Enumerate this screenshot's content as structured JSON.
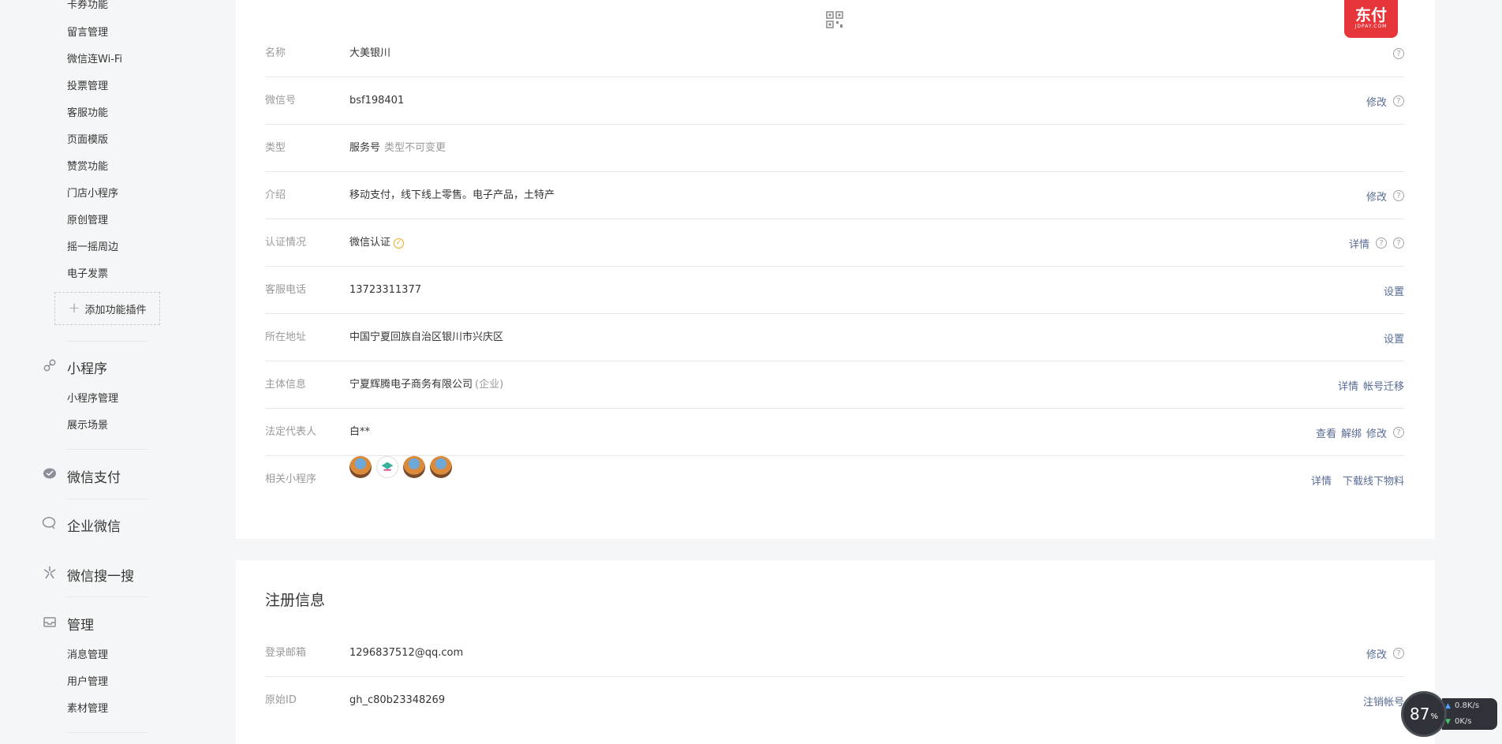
{
  "sidebar": {
    "top_items": [
      "卡券功能",
      "留言管理",
      "微信连Wi-Fi",
      "投票管理",
      "客服功能",
      "页面模版",
      "赞赏功能",
      "门店小程序",
      "原创管理",
      "摇一摇周边",
      "电子发票"
    ],
    "add_plugin_label": "添加功能插件",
    "sections": [
      {
        "title": "小程序",
        "icon": "link-icon",
        "items": [
          "小程序管理",
          "展示场景"
        ]
      },
      {
        "title": "微信支付",
        "icon": "wechat-pay-icon",
        "items": []
      },
      {
        "title": "企业微信",
        "icon": "chat-bubble-icon",
        "items": []
      },
      {
        "title": "微信搜一搜",
        "icon": "search-star-icon",
        "items": []
      },
      {
        "title": "管理",
        "icon": "inbox-icon",
        "items": [
          "消息管理",
          "用户管理",
          "素材管理"
        ]
      }
    ]
  },
  "brand_badge": {
    "text": "东付",
    "sub": "JDPAY.COM",
    "color": "#e7363a"
  },
  "account_info": {
    "rows": [
      {
        "label": "名称",
        "value": "大美银川",
        "actions": []
      },
      {
        "label": "微信号",
        "value": "bsf198401",
        "actions": [
          "修改"
        ]
      },
      {
        "label": "类型",
        "value": "服务号",
        "note": "类型不可变更",
        "actions": []
      },
      {
        "label": "介绍",
        "value": "移动支付，线下线上零售。电子产品，土特产",
        "actions": [
          "修改"
        ]
      },
      {
        "label": "认证情况",
        "value": "微信认证",
        "actions": [
          "详情"
        ]
      },
      {
        "label": "客服电话",
        "value": "13723311377",
        "actions": [
          "设置"
        ]
      },
      {
        "label": "所在地址",
        "value": "中国宁夏回族自治区银川市兴庆区",
        "actions": [
          "设置"
        ]
      },
      {
        "label": "主体信息",
        "value": "宁夏辉腾电子商务有限公司",
        "note": "(企业)",
        "actions": [
          "详情",
          "帐号迁移"
        ]
      },
      {
        "label": "法定代表人",
        "value": "白**",
        "actions": [
          "查看",
          "解绑",
          "修改"
        ]
      },
      {
        "label": "相关小程序",
        "value": "",
        "actions": [
          "详情",
          "下载线下物料"
        ]
      }
    ]
  },
  "registration": {
    "title": "注册信息",
    "rows": [
      {
        "label": "登录邮箱",
        "value": "1296837512@qq.com",
        "actions": [
          "修改"
        ]
      },
      {
        "label": "原始ID",
        "value": "gh_c80b23348269",
        "actions": [
          "注销帐号"
        ]
      }
    ]
  },
  "net_widget": {
    "percent": "87",
    "unit": "%",
    "up": "0.8K/s",
    "down": "0K/s"
  },
  "help_glyph": "?",
  "check_glyph": "✓",
  "colors": {
    "link": "#576b95",
    "label": "#9a9a9a",
    "verify": "#f0a71e"
  }
}
